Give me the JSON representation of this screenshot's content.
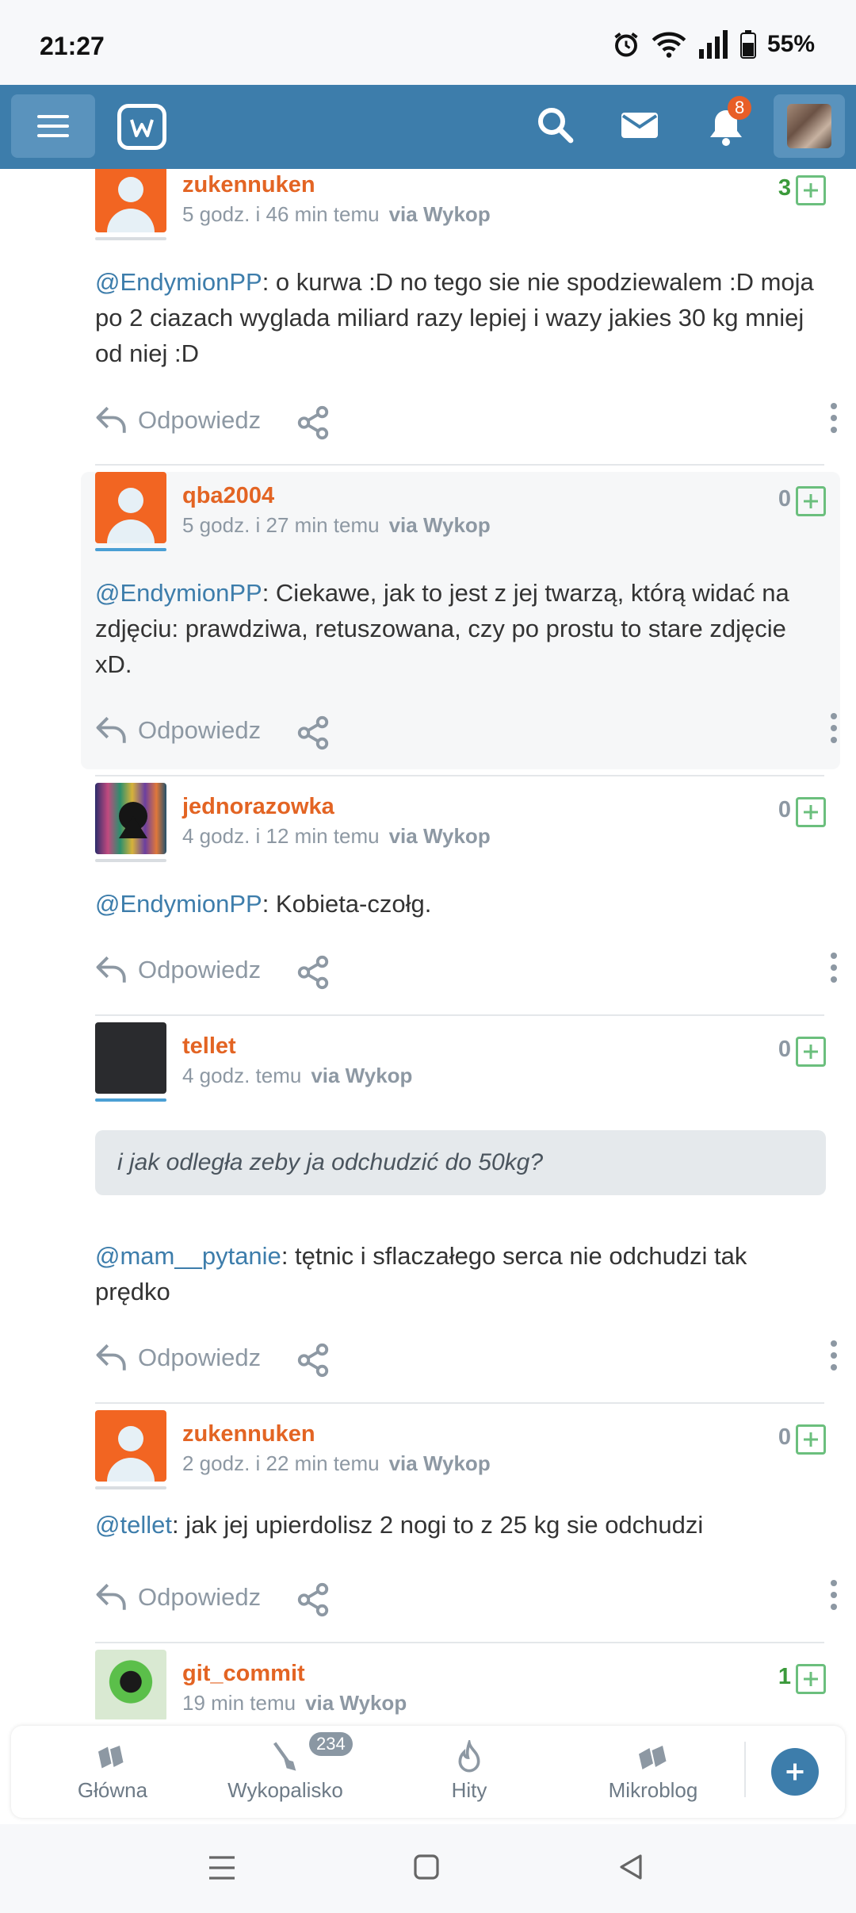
{
  "status_bar": {
    "time": "21:27",
    "battery": "55%"
  },
  "app_bar": {
    "notifications_count": "8"
  },
  "posts": [
    {
      "username": "zukennuken",
      "time": "5 godz. i 46 min temu",
      "via": "via Wykop",
      "votes": "3",
      "mention": "@EndymionPP",
      "text": ": o kurwa :D no tego sie nie spodziewalem :D moja po 2 ciazach wyglada miliard razy lepiej i wazy jakies 30 kg mniej od niej :D",
      "reply_label": "Odpowiedz"
    },
    {
      "username": "qba2004",
      "time": "5 godz. i 27 min temu",
      "via": "via Wykop",
      "votes": "0",
      "mention": "@EndymionPP",
      "text": ": Ciekawe, jak to jest z jej twarzą, którą widać na zdjęciu: prawdziwa, retuszowana, czy po prostu to stare zdjęcie xD.",
      "reply_label": "Odpowiedz"
    },
    {
      "username": "jednorazowka",
      "time": "4 godz. i 12 min temu",
      "via": "via Wykop",
      "votes": "0",
      "mention": "@EndymionPP",
      "text": ": Kobieta-czołg.",
      "reply_label": "Odpowiedz"
    },
    {
      "username": "tellet",
      "time": "4 godz. temu",
      "via": "via Wykop",
      "votes": "0",
      "quote": "i jak odległa zeby ja odchudzić do 50kg?",
      "mention": "@mam__pytanie",
      "text": ": tętnic i sflaczałego serca nie odchudzi tak prędko",
      "reply_label": "Odpowiedz"
    },
    {
      "username": "zukennuken",
      "time": "2 godz. i 22 min temu",
      "via": "via Wykop",
      "votes": "0",
      "mention": "@tellet",
      "text": ": jak jej upierdolisz 2 nogi to z 25 kg sie odchudzi",
      "reply_label": "Odpowiedz"
    },
    {
      "username": "git_commit",
      "time": "19 min temu",
      "via": "via Wykop",
      "votes": "1"
    }
  ],
  "bottom_nav": {
    "items": [
      {
        "label": "Główna"
      },
      {
        "label": "Wykopalisko",
        "badge": "234"
      },
      {
        "label": "Hity"
      },
      {
        "label": "Mikroblog"
      }
    ]
  },
  "colors": {
    "brand": "#3d7dab",
    "username": "#e36423",
    "vote_green": "#3b9a3b",
    "muted": "#8d98a3"
  }
}
